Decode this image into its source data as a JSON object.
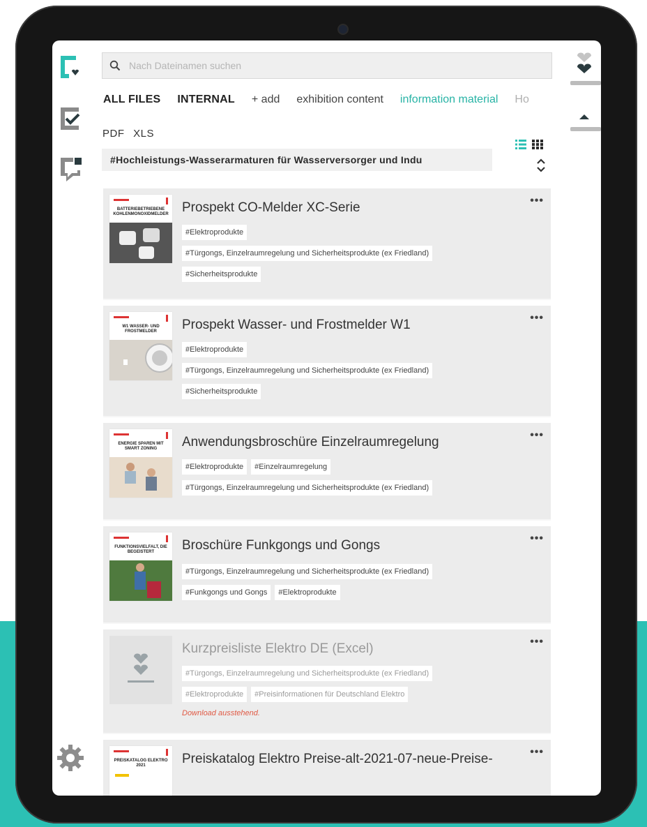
{
  "search": {
    "placeholder": "Nach Dateinamen suchen"
  },
  "tabs": [
    {
      "label": "ALL FILES"
    },
    {
      "label": "INTERNAL"
    },
    {
      "label": "+ add"
    },
    {
      "label": "exhibition content"
    },
    {
      "label": "information material"
    },
    {
      "label": "Ho"
    }
  ],
  "filetypes": [
    "PDF",
    "XLS"
  ],
  "filter": {
    "label": "#Hochleistungs-Wasserarmaturen für Wasserversorger und Indu"
  },
  "files": [
    {
      "title": "Prospekt CO-Melder XC-Serie",
      "thumb_caption": "BATTERIEBETRIEBENE KOHLENMONOXIDMELDER",
      "tags": [
        "#Elektroprodukte",
        "#Türgongs, Einzelraumregelung und Sicherheitsprodukte (ex Friedland)",
        "#Sicherheitsprodukte"
      ],
      "menu": "•••"
    },
    {
      "title": "Prospekt Wasser- und Frostmelder W1",
      "thumb_caption": "W1 WASSER- UND FROSTMELDER",
      "tags": [
        "#Elektroprodukte",
        "#Türgongs, Einzelraumregelung und Sicherheitsprodukte (ex Friedland)",
        "#Sicherheitsprodukte"
      ],
      "menu": "•••"
    },
    {
      "title": "Anwendungsbroschüre Einzelraumregelung",
      "thumb_caption": "ENERGIE SPAREN MIT SMART ZONING",
      "tags": [
        "#Elektroprodukte",
        "#Einzelraumregelung",
        "#Türgongs, Einzelraumregelung und Sicherheitsprodukte (ex Friedland)"
      ],
      "menu": "•••"
    },
    {
      "title": "Broschüre Funkgongs und Gongs",
      "thumb_caption": "FUNKTIONSVIELFALT, DIE BEGEISTERT",
      "tags": [
        "#Türgongs, Einzelraumregelung und Sicherheitsprodukte (ex Friedland)",
        "#Funkgongs und Gongs",
        "#Elektroprodukte"
      ],
      "menu": "•••"
    },
    {
      "title": "Kurzpreisliste Elektro DE (Excel)",
      "tags": [
        "#Türgongs, Einzelraumregelung und Sicherheitsprodukte (ex Friedland)",
        "#Elektroprodukte",
        "#Preisinformationen für Deutschland Elektro"
      ],
      "status": "Download ausstehend.",
      "menu": "•••"
    },
    {
      "title": "Preiskatalog Elektro Preise-alt-2021-07-neue-Preise-",
      "thumb_caption": "PREISKATALOG ELEKTRO 2021",
      "tags": [],
      "menu": "•••"
    }
  ],
  "colors": {
    "accent": "#27b3a5",
    "teal_bg": "#2cc0b4",
    "error": "#e05a45"
  }
}
